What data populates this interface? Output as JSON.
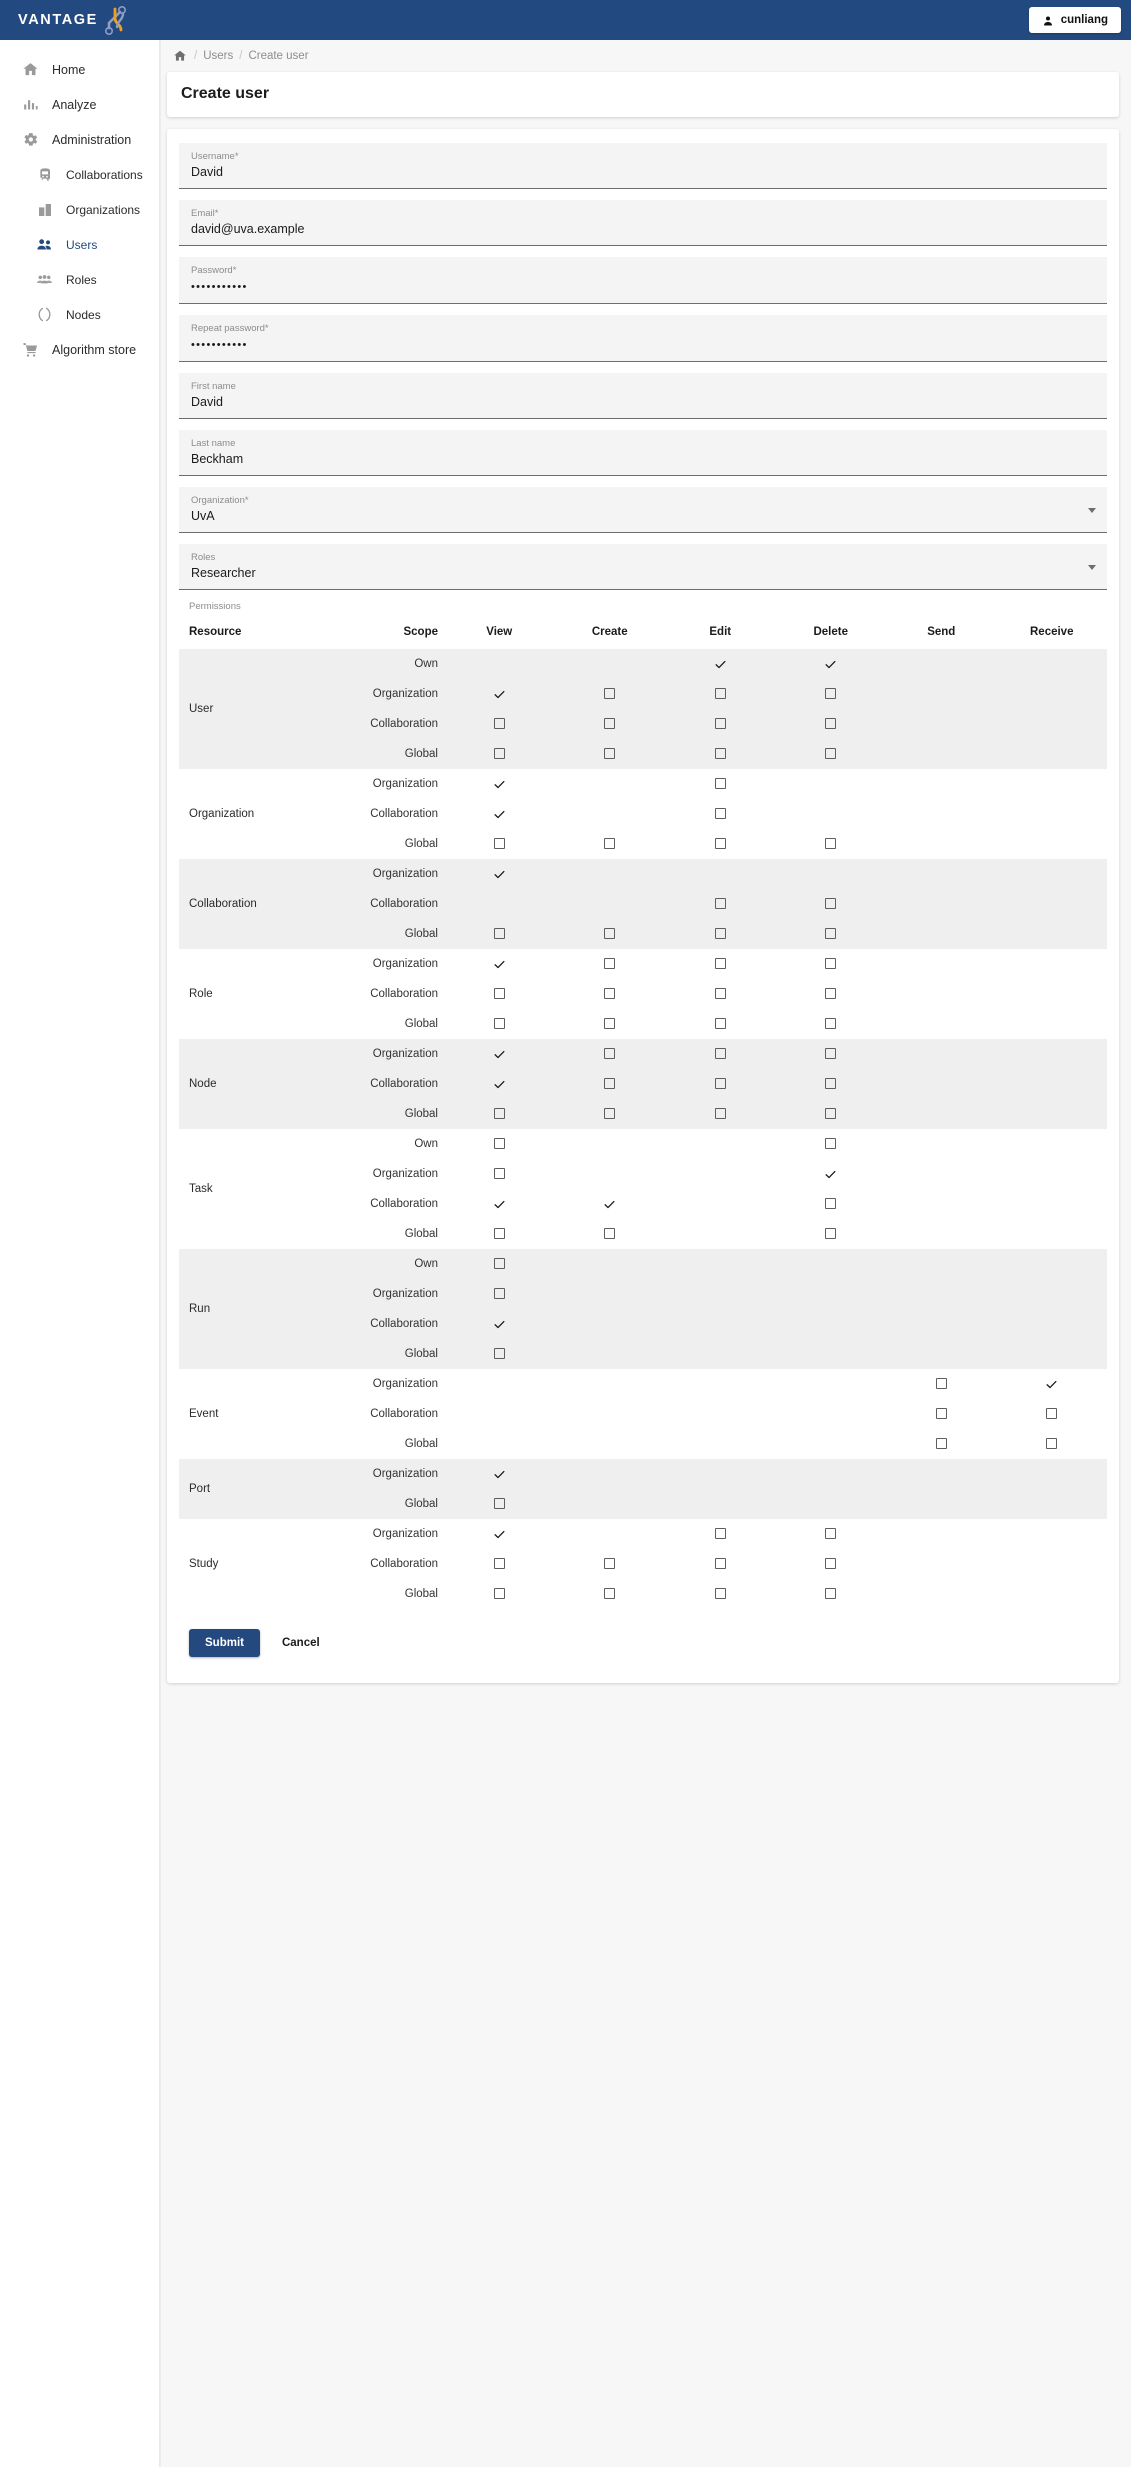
{
  "brand": {
    "name": "VANTAGE",
    "logo_icon": "vantage-logo-icon"
  },
  "topbar": {
    "user_name": "cunliang",
    "user_icon": "person-icon"
  },
  "sidebar": {
    "items": [
      {
        "label": "Home",
        "icon": "home-icon",
        "sub": false,
        "active": false
      },
      {
        "label": "Analyze",
        "icon": "bar-chart-icon",
        "sub": false,
        "active": false
      },
      {
        "label": "Administration",
        "icon": "gear-icon",
        "sub": false,
        "active": false
      },
      {
        "label": "Collaborations",
        "icon": "train-icon",
        "sub": true,
        "active": false
      },
      {
        "label": "Organizations",
        "icon": "building-icon",
        "sub": true,
        "active": false
      },
      {
        "label": "Users",
        "icon": "people-icon",
        "sub": true,
        "active": true
      },
      {
        "label": "Roles",
        "icon": "roles-icon",
        "sub": true,
        "active": false
      },
      {
        "label": "Nodes",
        "icon": "node-icon",
        "sub": true,
        "active": false
      },
      {
        "label": "Algorithm store",
        "icon": "store-icon",
        "sub": false,
        "active": false
      }
    ]
  },
  "breadcrumb": {
    "home_icon": "home-icon",
    "items": [
      "Users",
      "Create user"
    ],
    "separator": "/"
  },
  "page": {
    "title": "Create user"
  },
  "form": {
    "fields": [
      {
        "label": "Username*",
        "value": "David",
        "type": "text"
      },
      {
        "label": "Email*",
        "value": "david@uva.example",
        "type": "text"
      },
      {
        "label": "Password*",
        "value": "•••••••••••",
        "type": "password"
      },
      {
        "label": "Repeat password*",
        "value": "•••••••••••",
        "type": "password"
      },
      {
        "label": "First name",
        "value": "David",
        "type": "text"
      },
      {
        "label": "Last name",
        "value": "Beckham",
        "type": "text"
      },
      {
        "label": "Organization*",
        "value": "UvA",
        "type": "select"
      },
      {
        "label": "Roles",
        "value": "Researcher",
        "type": "select"
      }
    ]
  },
  "permissions": {
    "label": "Permissions",
    "columns": [
      "Resource",
      "Scope",
      "View",
      "Create",
      "Edit",
      "Delete",
      "Send",
      "Receive"
    ],
    "groups": [
      {
        "resource": "User",
        "shaded": true,
        "rows": [
          {
            "scope": "Own",
            "cells": [
              "none",
              "none",
              "check",
              "check",
              "none",
              "none"
            ]
          },
          {
            "scope": "Organization",
            "cells": [
              "check",
              "box",
              "box",
              "box",
              "none",
              "none"
            ]
          },
          {
            "scope": "Collaboration",
            "cells": [
              "box",
              "box",
              "box",
              "box",
              "none",
              "none"
            ]
          },
          {
            "scope": "Global",
            "cells": [
              "box",
              "box",
              "box",
              "box",
              "none",
              "none"
            ]
          }
        ]
      },
      {
        "resource": "Organization",
        "shaded": false,
        "rows": [
          {
            "scope": "Organization",
            "cells": [
              "check",
              "none",
              "box",
              "none",
              "none",
              "none"
            ]
          },
          {
            "scope": "Collaboration",
            "cells": [
              "check",
              "none",
              "box",
              "none",
              "none",
              "none"
            ]
          },
          {
            "scope": "Global",
            "cells": [
              "box",
              "box",
              "box",
              "box",
              "none",
              "none"
            ]
          }
        ]
      },
      {
        "resource": "Collaboration",
        "shaded": true,
        "rows": [
          {
            "scope": "Organization",
            "cells": [
              "check",
              "none",
              "none",
              "none",
              "none",
              "none"
            ]
          },
          {
            "scope": "Collaboration",
            "cells": [
              "none",
              "none",
              "box",
              "box",
              "none",
              "none"
            ]
          },
          {
            "scope": "Global",
            "cells": [
              "box",
              "box",
              "box",
              "box",
              "none",
              "none"
            ]
          }
        ]
      },
      {
        "resource": "Role",
        "shaded": false,
        "rows": [
          {
            "scope": "Organization",
            "cells": [
              "check",
              "box",
              "box",
              "box",
              "none",
              "none"
            ]
          },
          {
            "scope": "Collaboration",
            "cells": [
              "box",
              "box",
              "box",
              "box",
              "none",
              "none"
            ]
          },
          {
            "scope": "Global",
            "cells": [
              "box",
              "box",
              "box",
              "box",
              "none",
              "none"
            ]
          }
        ]
      },
      {
        "resource": "Node",
        "shaded": true,
        "rows": [
          {
            "scope": "Organization",
            "cells": [
              "check",
              "box",
              "box",
              "box",
              "none",
              "none"
            ]
          },
          {
            "scope": "Collaboration",
            "cells": [
              "check",
              "box",
              "box",
              "box",
              "none",
              "none"
            ]
          },
          {
            "scope": "Global",
            "cells": [
              "box",
              "box",
              "box",
              "box",
              "none",
              "none"
            ]
          }
        ]
      },
      {
        "resource": "Task",
        "shaded": false,
        "rows": [
          {
            "scope": "Own",
            "cells": [
              "box",
              "none",
              "none",
              "box",
              "none",
              "none"
            ]
          },
          {
            "scope": "Organization",
            "cells": [
              "box",
              "none",
              "none",
              "check",
              "none",
              "none"
            ]
          },
          {
            "scope": "Collaboration",
            "cells": [
              "check",
              "check",
              "none",
              "box",
              "none",
              "none"
            ]
          },
          {
            "scope": "Global",
            "cells": [
              "box",
              "box",
              "none",
              "box",
              "none",
              "none"
            ]
          }
        ]
      },
      {
        "resource": "Run",
        "shaded": true,
        "rows": [
          {
            "scope": "Own",
            "cells": [
              "box",
              "none",
              "none",
              "none",
              "none",
              "none"
            ]
          },
          {
            "scope": "Organization",
            "cells": [
              "box",
              "none",
              "none",
              "none",
              "none",
              "none"
            ]
          },
          {
            "scope": "Collaboration",
            "cells": [
              "check",
              "none",
              "none",
              "none",
              "none",
              "none"
            ]
          },
          {
            "scope": "Global",
            "cells": [
              "box",
              "none",
              "none",
              "none",
              "none",
              "none"
            ]
          }
        ]
      },
      {
        "resource": "Event",
        "shaded": false,
        "rows": [
          {
            "scope": "Organization",
            "cells": [
              "none",
              "none",
              "none",
              "none",
              "box",
              "check"
            ]
          },
          {
            "scope": "Collaboration",
            "cells": [
              "none",
              "none",
              "none",
              "none",
              "box",
              "box"
            ]
          },
          {
            "scope": "Global",
            "cells": [
              "none",
              "none",
              "none",
              "none",
              "box",
              "box"
            ]
          }
        ]
      },
      {
        "resource": "Port",
        "shaded": true,
        "rows": [
          {
            "scope": "Organization",
            "cells": [
              "check",
              "none",
              "none",
              "none",
              "none",
              "none"
            ]
          },
          {
            "scope": "Global",
            "cells": [
              "box",
              "none",
              "none",
              "none",
              "none",
              "none"
            ]
          }
        ]
      },
      {
        "resource": "Study",
        "shaded": false,
        "rows": [
          {
            "scope": "Organization",
            "cells": [
              "check",
              "none",
              "box",
              "box",
              "none",
              "none"
            ]
          },
          {
            "scope": "Collaboration",
            "cells": [
              "box",
              "box",
              "box",
              "box",
              "none",
              "none"
            ]
          },
          {
            "scope": "Global",
            "cells": [
              "box",
              "box",
              "box",
              "box",
              "none",
              "none"
            ]
          }
        ]
      }
    ]
  },
  "actions": {
    "submit_label": "Submit",
    "cancel_label": "Cancel"
  },
  "colors": {
    "brand": "#234a80",
    "accent": "#24497e",
    "logo_orange": "#f0a020",
    "shade": "#efefef"
  }
}
